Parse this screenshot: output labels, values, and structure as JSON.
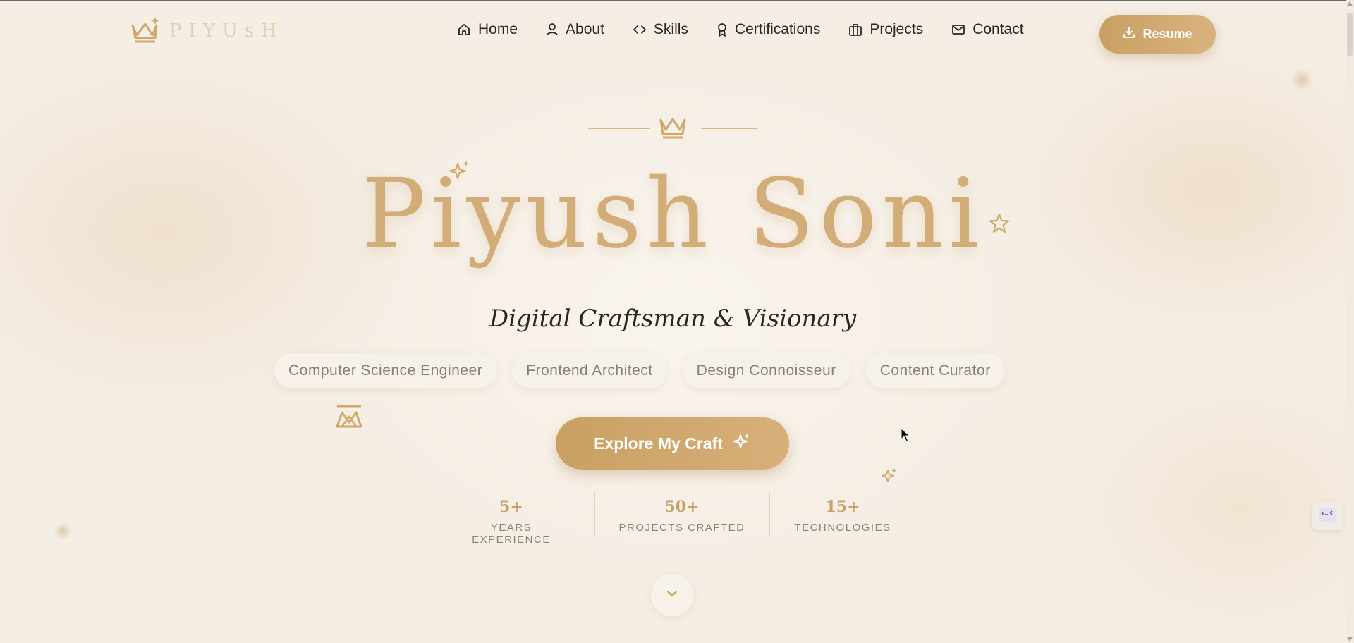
{
  "brand": {
    "name": "PIYUsH",
    "accent_color": "#d3ad78",
    "logo_icon": "crown-sparkle-icon"
  },
  "nav": {
    "items": [
      {
        "label": "Home",
        "icon": "home-icon"
      },
      {
        "label": "About",
        "icon": "user-icon"
      },
      {
        "label": "Skills",
        "icon": "code-icon"
      },
      {
        "label": "Certifications",
        "icon": "award-icon"
      },
      {
        "label": "Projects",
        "icon": "briefcase-icon"
      },
      {
        "label": "Contact",
        "icon": "mail-icon"
      }
    ],
    "resume_label": "Resume",
    "resume_icon": "download-icon"
  },
  "hero": {
    "name": "Piyush Soni",
    "tagline": "Digital Craftsman & Visionary",
    "roles": [
      "Computer Science Engineer",
      "Frontend Architect",
      "Design Connoisseur",
      "Content Curator"
    ],
    "cta_label": "Explore My Craft",
    "cta_icon": "sparkles-icon",
    "stats": [
      {
        "value": "5+",
        "label": "YEARS EXPERIENCE"
      },
      {
        "value": "50+",
        "label": "PROJECTS CRAFTED"
      },
      {
        "value": "15+",
        "label": "TECHNOLOGIES"
      }
    ],
    "scroll_icon": "chevron-down-icon"
  },
  "colors": {
    "background": "#f5eee5",
    "gold": "#c9a063",
    "text_dark": "#2a2521",
    "muted": "#8a7e74"
  }
}
